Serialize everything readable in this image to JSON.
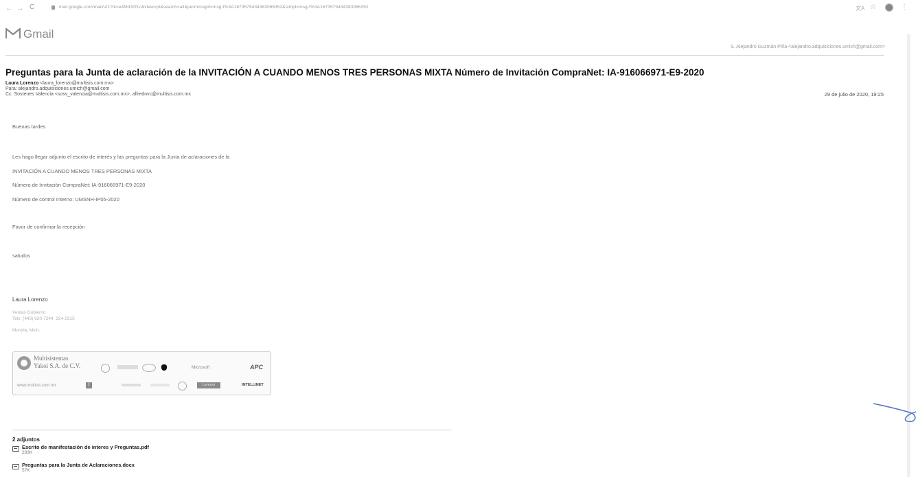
{
  "browser": {
    "back": "←",
    "forward": "→",
    "reload": "C",
    "url": "mail.google.com/mail/u/1?ik=e4f8d30f1c&view=pt&search=all&permmsgid=msg-f%3A1673579434383066352&simpl=msg-f%3A1673579434383066352",
    "translate_icon": "translate-icon",
    "star": "☆",
    "menu": "⋮"
  },
  "header": {
    "app_name": "Gmail",
    "account": "S. Alejandro Guzmán Piña <alejandro.adquisiciones.umich@gmail.com>"
  },
  "email": {
    "subject": "Preguntas para la Junta de aclaración de la INVITACIÓN A CUANDO MENOS TRES PERSONAS MIXTA Número de Invitación CompraNet: IA-916066971-E9-2020",
    "from_name": "Laura Lorenzo",
    "from_addr": "<laura_lorenzo@multisis.com.mx>",
    "to": "Para: alejandro.adquisiciones.umich@gmail.com",
    "cc": "Cc: Sostenes Valencia <sosv_valencia@multisis.com.mx>, alfredovc@multisis.com.mx",
    "date": "29 de julio de 2020, 19:25",
    "body": {
      "greeting": "Buenas tardes",
      "line1": "Les hago llegar adjunto el escrito de interés y las preguntas para la Junta de aclaraciones de la",
      "line2": "INVITACIÓN A CUANDO MENOS TRES PERSONAS MIXTA",
      "line3": "Número de Invitación CompraNet: IA-916066971-E9-2020",
      "line4": "Número de control Interno: UMSNH-IP05-2020",
      "line5": "Favor de confirmar la recepción",
      "closing": "saludos"
    },
    "signature": {
      "name": "Laura Lorenzo",
      "dept": "Ventas Gobierno",
      "phone": "Tels: (443) 620-7244, 324-2315",
      "city": "Morelia, Mich."
    },
    "banner": {
      "company_1": "Multisistemas",
      "company_2": "Yakoi S.A. de C.V.",
      "website": "www.multisis.com.mx",
      "fb": "f",
      "brands": [
        "Microsoft",
        "APC",
        "Lenovo",
        "INTELLINET"
      ]
    },
    "attachments": {
      "heading": "2 adjuntos",
      "items": [
        {
          "name": "Escrito de manifestación de interes y Preguntas.pdf",
          "size": "283K"
        },
        {
          "name": "Preguntas para la Junta de Aclaraciones.docx",
          "size": "57K"
        }
      ]
    }
  }
}
